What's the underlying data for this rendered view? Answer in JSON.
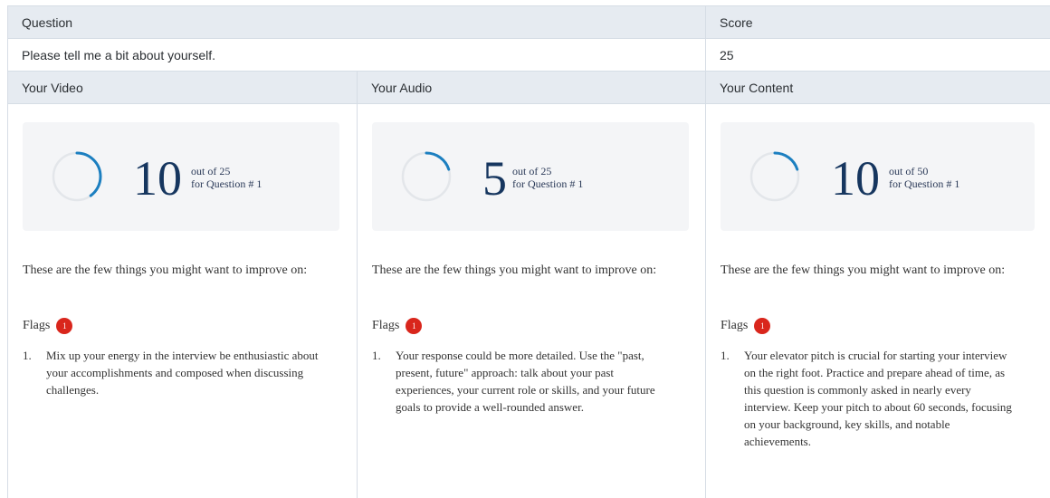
{
  "table": {
    "header": {
      "question_label": "Question",
      "score_label": "Score"
    },
    "row": {
      "question": "Please tell me a bit about yourself.",
      "score": "25"
    },
    "section_headers": {
      "video": "Your Video",
      "audio": "Your Audio",
      "content": "Your Content"
    }
  },
  "panels": {
    "video": {
      "score": "10",
      "out_of": "out of 25",
      "question_ref": "for Question # 1",
      "progress_fraction": 0.4,
      "improve_text": "These are the few things you might want to improve on:",
      "flags_label": "Flags",
      "flags_count": "1",
      "tips": [
        {
          "num": "1.",
          "text": "Mix up your energy in the interview be enthusiastic about your accomplishments and composed when discussing challenges."
        }
      ]
    },
    "audio": {
      "score": "5",
      "out_of": "out of 25",
      "question_ref": "for Question # 1",
      "progress_fraction": 0.2,
      "improve_text": "These are the few things you might want to improve on:",
      "flags_label": "Flags",
      "flags_count": "1",
      "tips": [
        {
          "num": "1.",
          "text": "Your response could be more detailed. Use the \"past, present, future\" approach: talk about your past experiences, your current role or skills, and your future goals to provide a well-rounded answer."
        }
      ]
    },
    "content": {
      "score": "10",
      "out_of": "out of 50",
      "question_ref": "for Question # 1",
      "progress_fraction": 0.2,
      "improve_text": "These are the few things you might want to improve on:",
      "flags_label": "Flags",
      "flags_count": "1",
      "tips": [
        {
          "num": "1.",
          "text": "Your elevator pitch is crucial for starting your interview on the right foot. Practice and prepare ahead of time, as this question is commonly asked in nearly every interview. Keep your pitch to about 60 seconds, focusing on your background, key skills, and notable achievements."
        }
      ]
    }
  },
  "colors": {
    "ring_track": "#e3e6ea",
    "ring_progress": "#1c7fc0",
    "ring_progress_dark": "#2a7a8a",
    "flag_badge": "#d9261c",
    "header_bg": "#e6ebf1"
  }
}
